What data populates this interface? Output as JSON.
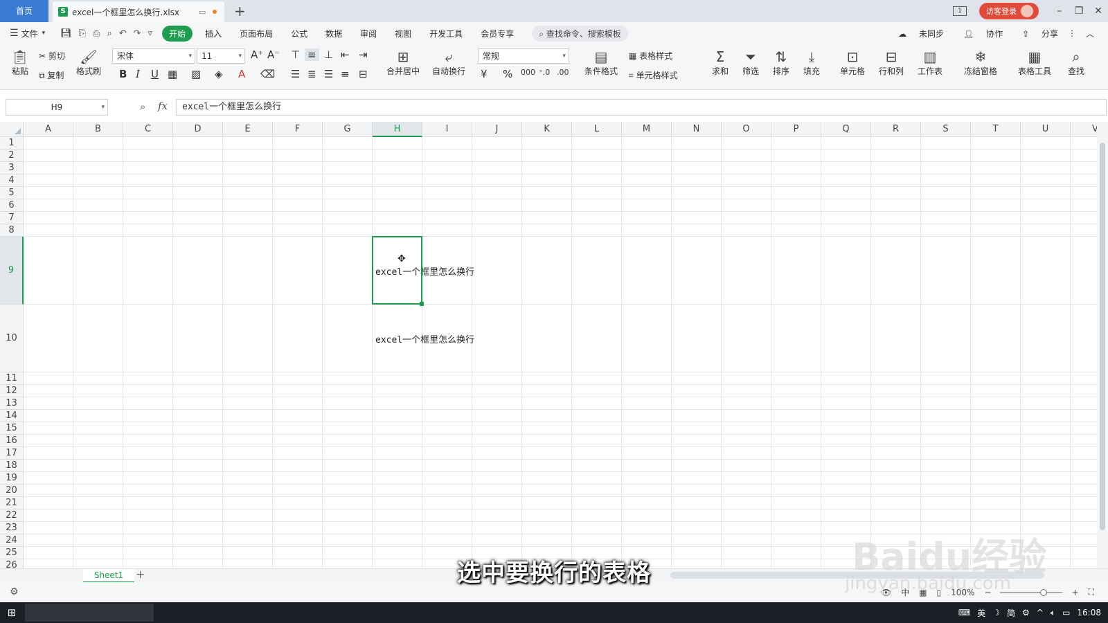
{
  "titlebar": {
    "home_tab": "首页",
    "file_tab": "excel一个框里怎么换行.xlsx",
    "file_icon": "S",
    "add_tab": "+",
    "layout_badge": "1",
    "login": "访客登录"
  },
  "menubar": {
    "file": "文件",
    "tabs": [
      "开始",
      "插入",
      "页面布局",
      "公式",
      "数据",
      "审阅",
      "视图",
      "开发工具",
      "会员专享"
    ],
    "search": "查找命令、搜索模板",
    "sync": "未同步",
    "collab": "协作",
    "share": "分享"
  },
  "ribbon": {
    "paste": "粘贴",
    "cut": "剪切",
    "copy": "复制",
    "format_painter": "格式刷",
    "font_name": "宋体",
    "font_size": "11",
    "merge_center": "合并居中",
    "auto_wrap": "自动换行",
    "number_format": "常规",
    "conditional_format": "条件格式",
    "table_style": "表格样式",
    "cell_style": "单元格样式",
    "sum": "求和",
    "filter": "筛选",
    "sort": "排序",
    "fill": "填充",
    "cell": "单元格",
    "row_col": "行和列",
    "worksheet": "工作表",
    "freeze": "冻结窗格",
    "table_tools": "表格工具",
    "find": "查找"
  },
  "formula_bar": {
    "name_box": "H9",
    "fx": "fx",
    "content": "excel一个框里怎么换行"
  },
  "grid": {
    "columns": [
      "A",
      "B",
      "C",
      "D",
      "E",
      "F",
      "G",
      "H",
      "I",
      "J",
      "K",
      "L",
      "M",
      "N",
      "O",
      "P",
      "Q",
      "R",
      "S",
      "T",
      "U",
      "V"
    ],
    "rows": [
      "1",
      "2",
      "3",
      "4",
      "5",
      "6",
      "7",
      "8",
      "9",
      "10",
      "11",
      "12",
      "13",
      "14",
      "15",
      "16",
      "17",
      "18",
      "19",
      "20",
      "21",
      "22",
      "23",
      "24",
      "25",
      "26"
    ],
    "selected_column": "H",
    "selected_row": "9",
    "cell_h9": "excel一个框里怎么换行",
    "cell_h10": "excel一个框里怎么换行"
  },
  "sheets": {
    "active": "Sheet1",
    "add": "+"
  },
  "status": {
    "input_mode": "中",
    "zoom": "100%"
  },
  "overlay": {
    "subtitle": "选中要换行的表格",
    "watermark": "Baidu经验",
    "watermark_url": "jingyan.baidu.com"
  },
  "taskbar": {
    "ime_lang": "英",
    "ime_simp": "简",
    "time": "16:08"
  },
  "colors": {
    "accent": "#1d9e4f",
    "home_tab": "#3a7bd5",
    "login": "#e04b3c"
  }
}
